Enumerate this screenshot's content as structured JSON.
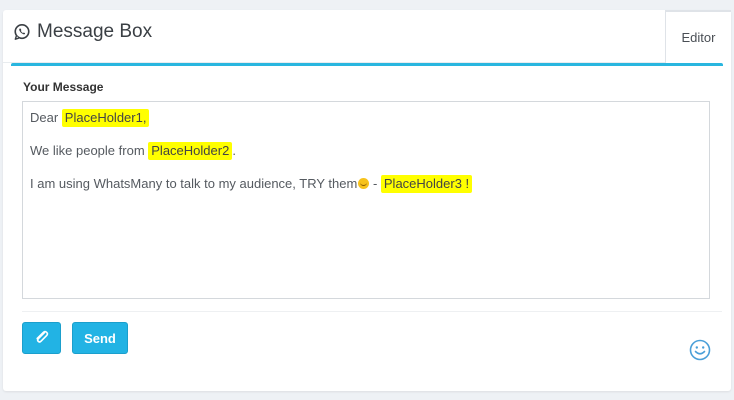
{
  "header": {
    "title": "Message Box",
    "icon": "whatsapp-icon"
  },
  "tabs": [
    {
      "label": "Editor",
      "active": true
    }
  ],
  "form": {
    "label": "Your Message",
    "lines": [
      {
        "prefix": "Dear ",
        "placeholder": "PlaceHolder1,",
        "suffix": ""
      },
      {
        "prefix": "We like people from ",
        "placeholder": "PlaceHolder2",
        "suffix": "."
      },
      {
        "prefix": "I am using WhatsMany to talk to my audience, TRY them",
        "middle": " - ",
        "placeholder": "PlaceHolder3 !",
        "suffix": ""
      }
    ]
  },
  "actions": {
    "attach_icon": "paperclip-icon",
    "send_label": "Send",
    "emoji_icon": "smiley-icon"
  },
  "colors": {
    "accent": "#29b6df",
    "button": "#22b3e4",
    "highlight": "#ffff00"
  }
}
